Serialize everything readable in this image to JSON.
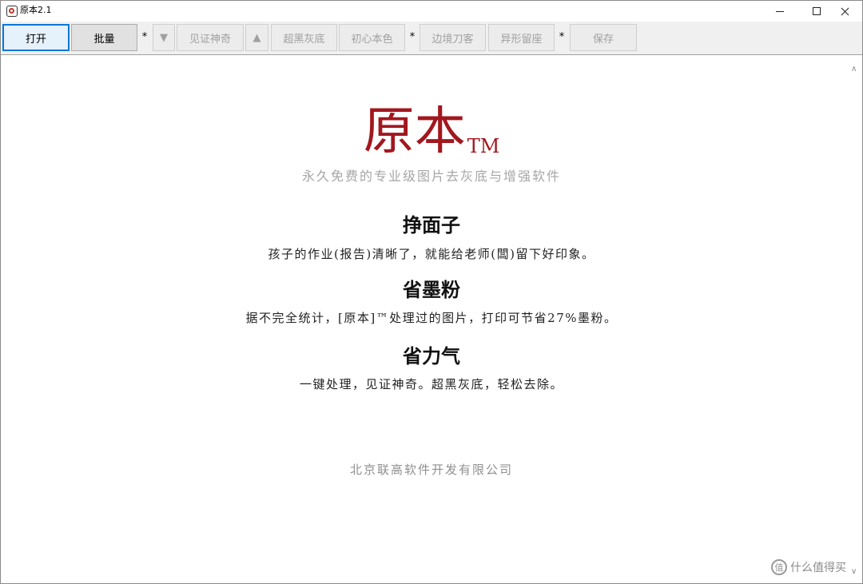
{
  "window": {
    "title": "原本2.1"
  },
  "toolbar": {
    "open_label": "打开",
    "batch_label": "批量",
    "sep1": "*",
    "down_arrow": "▼",
    "witness_label": "见证神奇",
    "up_arrow": "▲",
    "black_gray_label": "超黑灰底",
    "original_color_label": "初心本色",
    "sep2": "*",
    "border_knife_label": "边境刀客",
    "irregular_label": "异形留座",
    "sep3": "*",
    "save_label": "保存"
  },
  "main": {
    "logo": "原本",
    "logo_tm": "TM",
    "tagline": "永久免费的专业级图片去灰底与增强软件",
    "sections": [
      {
        "heading": "挣面子",
        "body": "孩子的作业(报告)清晰了，就能给老师(闆)留下好印象。"
      },
      {
        "heading": "省墨粉",
        "body": "据不完全统计，[原本]™处理过的图片，打印可节省27%墨粉。"
      },
      {
        "heading": "省力气",
        "body": "一键处理，见证神奇。超黑灰底，轻松去除。"
      }
    ],
    "company": "北京联高软件开发有限公司"
  },
  "watermark": {
    "icon_text": "值",
    "text": "什么值得买"
  },
  "icons": {
    "app": "app-logo-icon",
    "minimize": "minimize-icon",
    "maximize": "maximize-icon",
    "close": "close-icon",
    "scroll_up": "scroll-up-icon",
    "scroll_down": "scroll-down-icon"
  },
  "colors": {
    "logo_red": "#a2171e",
    "accent_blue": "#0078d7",
    "disabled_text": "#a0a0a0"
  }
}
